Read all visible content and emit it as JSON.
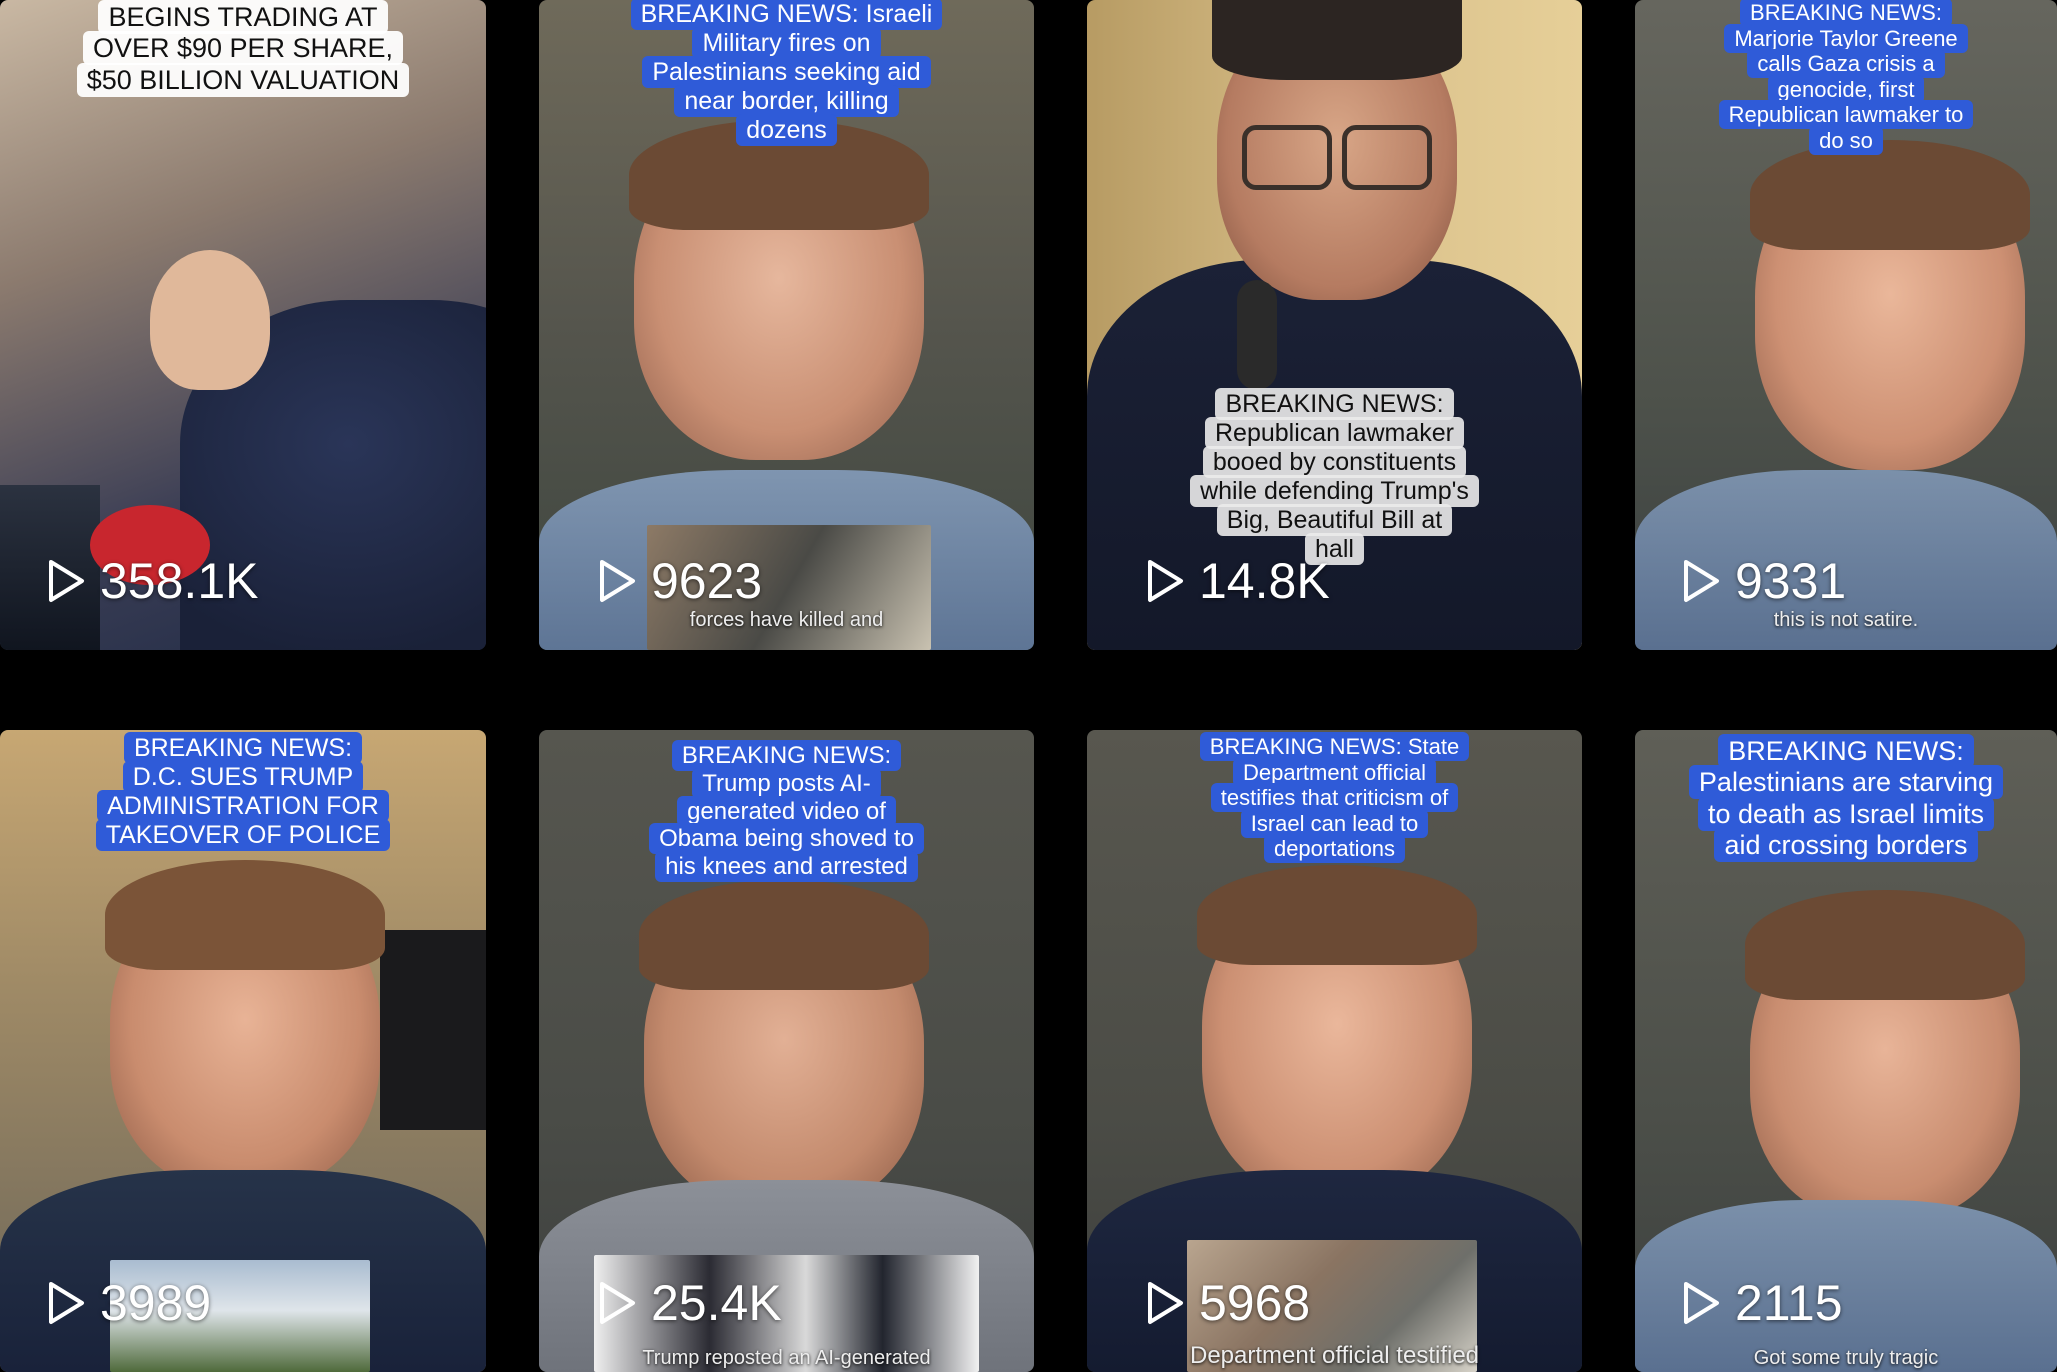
{
  "videos": [
    {
      "caption": "BEGINS TRADING AT\nOVER $90 PER SHARE,\n$50 BILLION VALUATION",
      "views": "358.1K",
      "subtitle": ""
    },
    {
      "caption": "BREAKING NEWS: Israeli\nMilitary fires on\nPalestinians seeking aid\nnear border, killing\ndozens",
      "views": "9623",
      "subtitle": "forces have killed and"
    },
    {
      "caption": "BREAKING NEWS:\nRepublican lawmaker\nbooed by constituents\nwhile defending Trump's\nBig, Beautiful Bill at\nhall",
      "views": "14.8K",
      "subtitle": ""
    },
    {
      "caption": "BREAKING NEWS:\nMarjorie Taylor Greene\ncalls Gaza crisis a\ngenocide, first\nRepublican lawmaker to\ndo so",
      "views": "9331",
      "subtitle": "this is not satire."
    },
    {
      "caption": "BREAKING NEWS:\nD.C. SUES TRUMP\nADMINISTRATION FOR\nTAKEOVER OF POLICE",
      "views": "3989",
      "subtitle": ""
    },
    {
      "caption": "BREAKING NEWS:\nTrump posts AI-\ngenerated video of\nObama being shoved to\nhis knees and arrested",
      "views": "25.4K",
      "subtitle": "Trump reposted an AI-generated"
    },
    {
      "caption": "BREAKING NEWS: State\nDepartment official\ntestifies that criticism of\nIsrael can lead to\ndeportations",
      "views": "5968",
      "subtitle": "Department official testified"
    },
    {
      "caption": "BREAKING NEWS:\nPalestinians are starving\nto death as Israel limits\naid crossing borders",
      "views": "2115",
      "subtitle": "Got some truly tragic"
    }
  ],
  "icons": {
    "play": "play-icon"
  },
  "colors": {
    "caption_blue": "#2f5bd8",
    "background": "#000000"
  }
}
